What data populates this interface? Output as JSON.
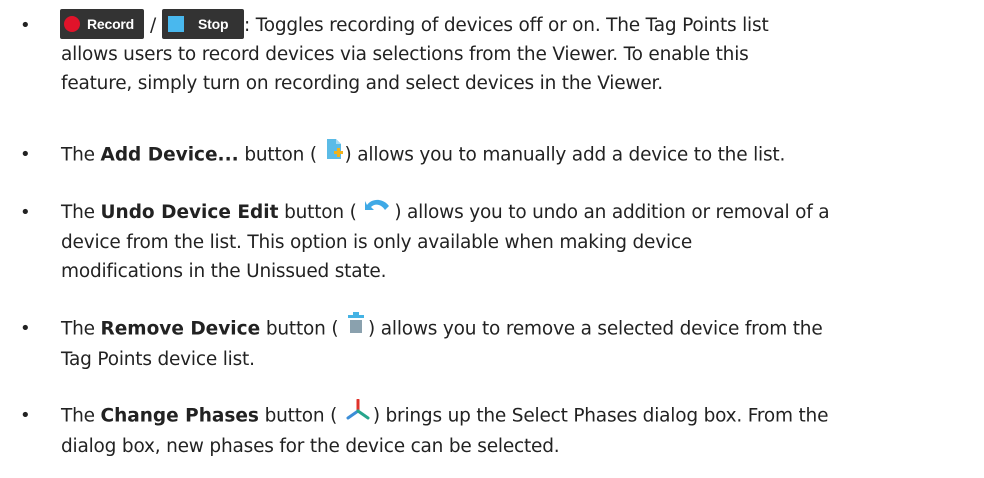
{
  "items": [
    {
      "record_label": "Record",
      "separator": "/",
      "stop_label": "Stop",
      "line1": ": Toggles recording of devices off or on. The Tag Points list",
      "line2": "allows users to record devices via selections from the Viewer. To enable this",
      "line3": "feature, simply turn on recording and select devices in the Viewer."
    },
    {
      "lead": "The ",
      "bold": "Add Device...",
      "pre_icon": " button (",
      "icon": "add-device-icon",
      "line1_rest": ") allows you to manually add a device to the list."
    },
    {
      "lead": "The ",
      "bold": "Undo Device Edit",
      "pre_icon": " button (",
      "icon": "undo-icon",
      "line1_rest": ") allows you to undo an addition or removal of a",
      "line2": "device from the list. This option is only available when making device",
      "line3": "modifications in the Unissued state."
    },
    {
      "lead": "The ",
      "bold": "Remove Device",
      "pre_icon": " button (",
      "icon": "trash-icon",
      "line1_rest": ") allows you to remove a selected device from the",
      "line2": "Tag Points device list."
    },
    {
      "lead": "The ",
      "bold": "Change Phases",
      "pre_icon": " button (",
      "icon": "phases-icon",
      "line1_rest": ") brings up the Select Phases dialog box. From the",
      "line2": "dialog box, new phases for the device can be selected."
    }
  ],
  "bullet": "•",
  "colors": {
    "record_red": "#e0132a",
    "stop_blue": "#49b8ee",
    "button_dark": "#333333",
    "text": "#222222"
  }
}
